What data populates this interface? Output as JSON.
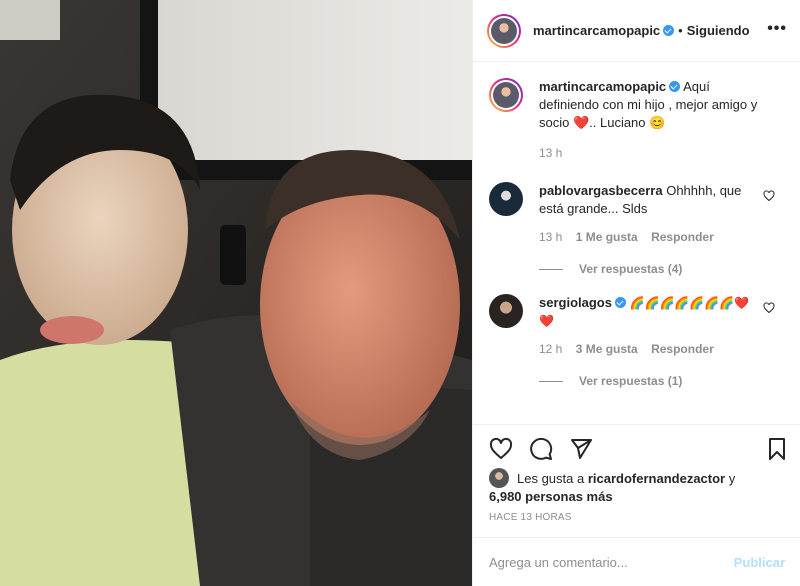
{
  "post": {
    "author": "martincarcamopapic",
    "follow_status": "Siguiendo",
    "more_icon": "more-horizontal-icon",
    "caption": "Aquí definiendo con mi hijo , mejor amigo y socio ❤️.. Luciano 😊",
    "caption_time": "13 h"
  },
  "comments": [
    {
      "user": "pablovargasbecerra",
      "text": "Ohhhhh, que está grande... Slds",
      "time": "13 h",
      "likes": "1 Me gusta",
      "reply": "Responder",
      "view_replies": "Ver respuestas (4)"
    },
    {
      "user": "sergiolagos",
      "text": "🌈🌈🌈🌈🌈🌈🌈❤️❤️",
      "time": "12 h",
      "likes": "3 Me gusta",
      "reply": "Responder",
      "view_replies": "Ver respuestas (1)"
    }
  ],
  "liked_by": {
    "prefix": "Les gusta a",
    "user": "ricardofernandezactor",
    "connector": "y",
    "others": "6,980 personas más"
  },
  "time_ago": "HACE 13 HORAS",
  "comment_box": {
    "placeholder": "Agrega un comentario...",
    "post_label": "Publicar"
  },
  "colors": {
    "accent": "#3897f0",
    "post_disabled": "#b2dffc",
    "muted": "#8e8e8e",
    "text": "#262626"
  }
}
